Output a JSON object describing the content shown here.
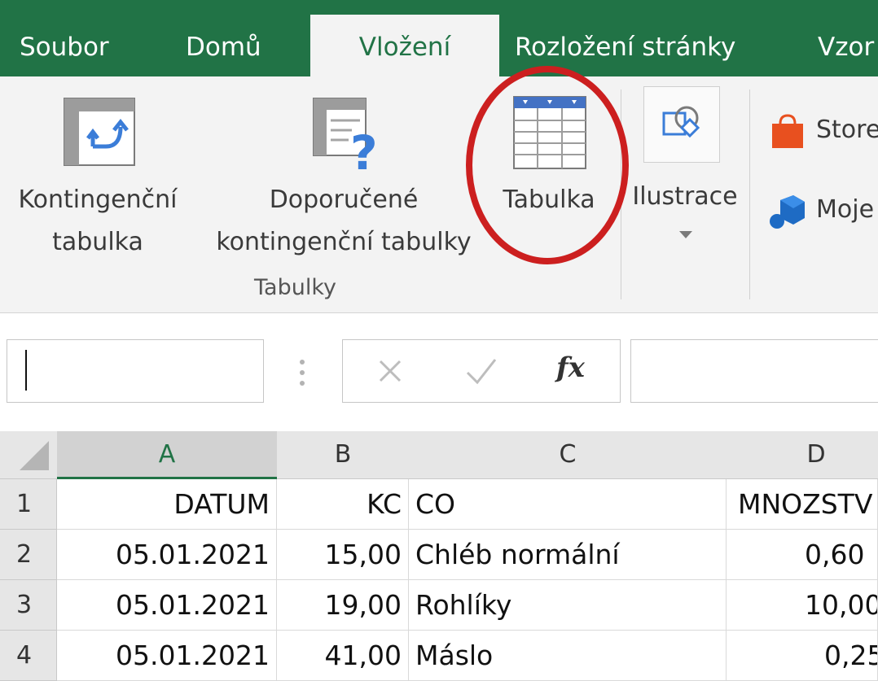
{
  "ribbon_tabs": [
    "Soubor",
    "Domů",
    "Vložení",
    "Rozložení stránky",
    "Vzor"
  ],
  "active_tab": "Vložení",
  "ribbon": {
    "pivot_label_1": "Kontingenční",
    "pivot_label_2": "tabulka",
    "recommended_label_1": "Doporučené",
    "recommended_label_2": "kontingenční tabulky",
    "table_label": "Tabulka",
    "illustrations_label": "Ilustrace",
    "group_tables_label": "Tabulky",
    "store_label": "Store",
    "my_addins_label": "Moje"
  },
  "formula_bar": {
    "name_box_value": "",
    "fx_label": "fx"
  },
  "grid": {
    "columns": [
      "A",
      "B",
      "C",
      "D"
    ],
    "selected_column": "A",
    "rows": [
      {
        "num": "1",
        "cells": [
          "DATUM",
          "KC",
          "CO",
          "MNOZSTV"
        ]
      },
      {
        "num": "2",
        "cells": [
          "05.01.2021",
          "15,00",
          "Chléb normální",
          "0,60"
        ]
      },
      {
        "num": "3",
        "cells": [
          "05.01.2021",
          "19,00",
          "Rohlíky",
          "10,00"
        ]
      },
      {
        "num": "4",
        "cells": [
          "05.01.2021",
          "41,00",
          "Máslo",
          "0,25"
        ]
      }
    ]
  },
  "annotation": {
    "highlight_target": "Tabulka",
    "color": "#cc1f1f"
  },
  "colors": {
    "excel_green": "#217346",
    "ribbon_bg": "#f3f3f3",
    "icon_blue": "#4472c4",
    "store_orange": "#e8501f",
    "addin_blue": "#1e6bc4"
  }
}
